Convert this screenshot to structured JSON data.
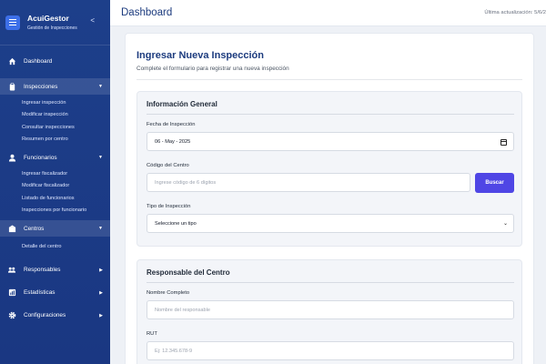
{
  "app": {
    "title": "AcuiGestor",
    "subtitle": "Gestión de Inspecciones",
    "collapse_icon": "chevron-left-icon"
  },
  "sidebar": {
    "items": [
      {
        "label": "Dashboard",
        "icon": "home-icon"
      },
      {
        "label": "Inspecciones",
        "icon": "clipboard-icon",
        "expanded": true,
        "subitems": [
          "Ingresar inspección",
          "Modificar inspección",
          "Consultar inspecciones",
          "Resumen por centro"
        ]
      },
      {
        "label": "Funcionarios",
        "icon": "user-icon",
        "expanded": true,
        "subitems": [
          "Ingresar fiscalizador",
          "Modificar fiscalizador",
          "Listado de funcionarios",
          "Inspecciones por funcionario"
        ]
      },
      {
        "label": "Centros",
        "icon": "building-icon",
        "expanded": true,
        "subitems": [
          "Detalle del centro"
        ]
      },
      {
        "label": "Responsables",
        "icon": "users-icon"
      },
      {
        "label": "Estadísticas",
        "icon": "chart-icon"
      },
      {
        "label": "Configuraciones",
        "icon": "gear-icon"
      }
    ]
  },
  "topbar": {
    "title": "Dashboard",
    "last_update": "Última actualización: 5/6/2"
  },
  "form": {
    "title": "Ingresar Nueva Inspección",
    "description": "Complete el formulario para registrar una nueva inspección",
    "general": {
      "title": "Información General",
      "date_label": "Fecha de Inspección",
      "date_value": "06 - May - 2025",
      "center_label": "Código del Centro",
      "center_placeholder": "Ingrese código de 6 dígitos",
      "search_button": "Buscar",
      "type_label": "Tipo de Inspección",
      "type_value": "Seleccione un tipo"
    },
    "responsible": {
      "title": "Responsable del Centro",
      "name_label": "Nombre Completo",
      "name_placeholder": "Nombre del responsable",
      "rut_label": "RUT",
      "rut_placeholder": "Ej: 12.345.678-9"
    }
  }
}
